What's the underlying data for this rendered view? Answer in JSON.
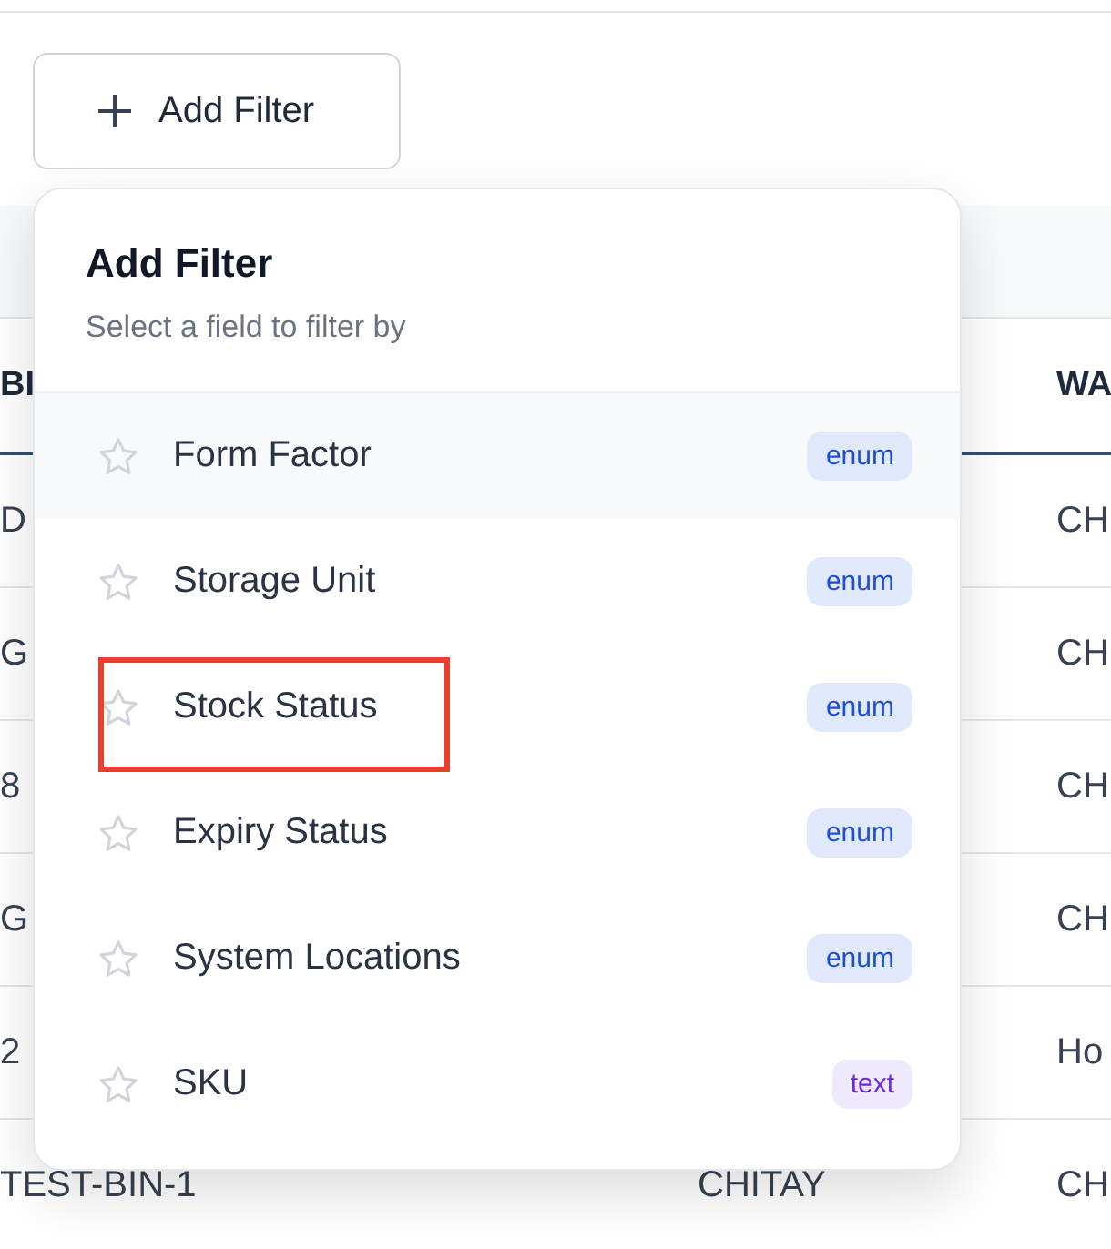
{
  "add_filter_button": {
    "label": "Add Filter"
  },
  "table": {
    "columns": [
      {
        "header": "BI"
      },
      {},
      {
        "header": "WA"
      }
    ],
    "rows": [
      {
        "column_1": "D",
        "column_3": "CH"
      },
      {
        "column_1": "G",
        "column_3": "CH"
      },
      {
        "column_1": "8",
        "column_3": "CH"
      },
      {
        "column_1": "G",
        "column_3": "CH"
      },
      {
        "column_1": "2",
        "column_3": "Ho"
      },
      {
        "column_1": "TEST-BIN-1",
        "column_2": "CHITAY",
        "column_3": "CH"
      }
    ]
  },
  "filter_menu": {
    "title": "Add Filter",
    "subtitle": "Select a field to filter by",
    "items": [
      {
        "label": "Form Factor",
        "type": "enum",
        "hovered": true,
        "highlighted": false
      },
      {
        "label": "Storage Unit",
        "type": "enum",
        "hovered": false,
        "highlighted": false
      },
      {
        "label": "Stock Status",
        "type": "enum",
        "hovered": false,
        "highlighted": true
      },
      {
        "label": "Expiry Status",
        "type": "enum",
        "hovered": false,
        "highlighted": false
      },
      {
        "label": "System Locations",
        "type": "enum",
        "hovered": false,
        "highlighted": false
      },
      {
        "label": "SKU",
        "type": "text",
        "hovered": false,
        "highlighted": false
      }
    ]
  }
}
